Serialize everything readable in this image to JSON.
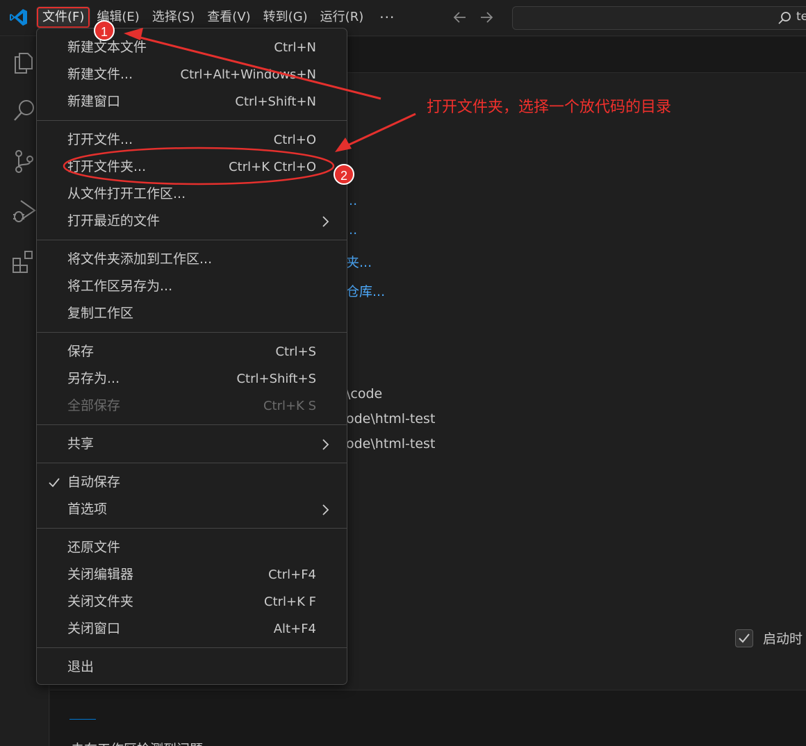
{
  "titlebar": {
    "menu": [
      "文件(F)",
      "编辑(E)",
      "选择(S)",
      "查看(V)",
      "转到(G)",
      "运行(R)"
    ],
    "more": "···",
    "search_text": "te"
  },
  "file_menu": {
    "groups": [
      [
        {
          "label": "新建文本文件",
          "shortcut": "Ctrl+N"
        },
        {
          "label": "新建文件...",
          "shortcut": "Ctrl+Alt+Windows+N"
        },
        {
          "label": "新建窗口",
          "shortcut": "Ctrl+Shift+N"
        }
      ],
      [
        {
          "label": "打开文件...",
          "shortcut": "Ctrl+O"
        },
        {
          "label": "打开文件夹...",
          "shortcut": "Ctrl+K Ctrl+O"
        },
        {
          "label": "从文件打开工作区...",
          "shortcut": ""
        },
        {
          "label": "打开最近的文件",
          "shortcut": "",
          "submenu": true
        }
      ],
      [
        {
          "label": "将文件夹添加到工作区...",
          "shortcut": ""
        },
        {
          "label": "将工作区另存为...",
          "shortcut": ""
        },
        {
          "label": "复制工作区",
          "shortcut": ""
        }
      ],
      [
        {
          "label": "保存",
          "shortcut": "Ctrl+S"
        },
        {
          "label": "另存为...",
          "shortcut": "Ctrl+Shift+S"
        },
        {
          "label": "全部保存",
          "shortcut": "Ctrl+K S",
          "disabled": true
        }
      ],
      [
        {
          "label": "共享",
          "shortcut": "",
          "submenu": true
        }
      ],
      [
        {
          "label": "自动保存",
          "shortcut": "",
          "checked": true
        },
        {
          "label": "首选项",
          "shortcut": "",
          "submenu": true
        }
      ],
      [
        {
          "label": "还原文件",
          "shortcut": ""
        },
        {
          "label": "关闭编辑器",
          "shortcut": "Ctrl+F4"
        },
        {
          "label": "关闭文件夹",
          "shortcut": "Ctrl+K F"
        },
        {
          "label": "关闭窗口",
          "shortcut": "Alt+F4"
        }
      ],
      [
        {
          "label": "退出",
          "shortcut": ""
        }
      ]
    ]
  },
  "welcome": {
    "start_fragments": [
      "...",
      "...",
      "夹...",
      "仓库..."
    ],
    "recent_fragments": [
      "\\code",
      "ode\\html-test",
      "ode\\html-test"
    ],
    "show_on_startup": "启动时"
  },
  "panel": {
    "message": "未在工作区检测到问题。"
  },
  "annotations": {
    "badge1": "1",
    "badge2": "2",
    "note": "打开文件夹，选择一个放代码的目录"
  },
  "colors": {
    "accent": "#0078d4",
    "annotation": "#e5302d",
    "link": "#4daafc"
  }
}
